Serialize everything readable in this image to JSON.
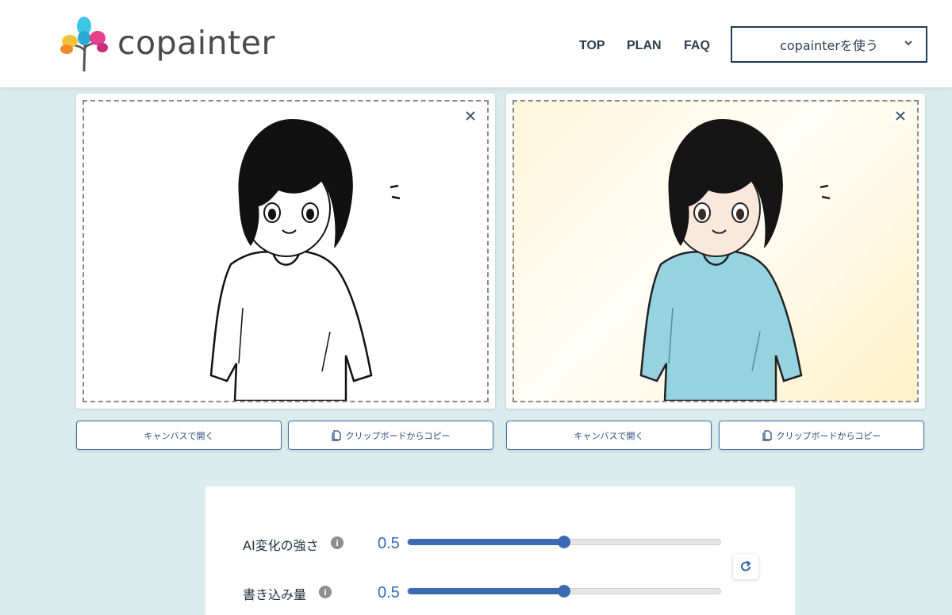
{
  "header": {
    "logo_text": "copainter",
    "nav": [
      "TOP",
      "PLAN",
      "FAQ"
    ],
    "use_button_label": "copainterを使う"
  },
  "panels": [
    {
      "open_canvas_label": "キャンバスで開く",
      "copy_clipboard_label": "クリップボードからコピー"
    },
    {
      "open_canvas_label": "キャンバスで開く",
      "copy_clipboard_label": "クリップボードからコピー"
    }
  ],
  "settings": {
    "ai_strength": {
      "label": "AI変化の強さ",
      "value": "0.5",
      "level": 0.5
    },
    "write_amount": {
      "label": "書き込み量",
      "value": "0.5",
      "level": 0.5
    }
  },
  "colors": {
    "accent": "#3b6ab3",
    "background": "#dbeced",
    "shirt": "#95d3e0"
  },
  "icons": [
    "close-icon",
    "clipboard-icon",
    "info-icon",
    "reset-icon",
    "chevron-down-icon"
  ]
}
